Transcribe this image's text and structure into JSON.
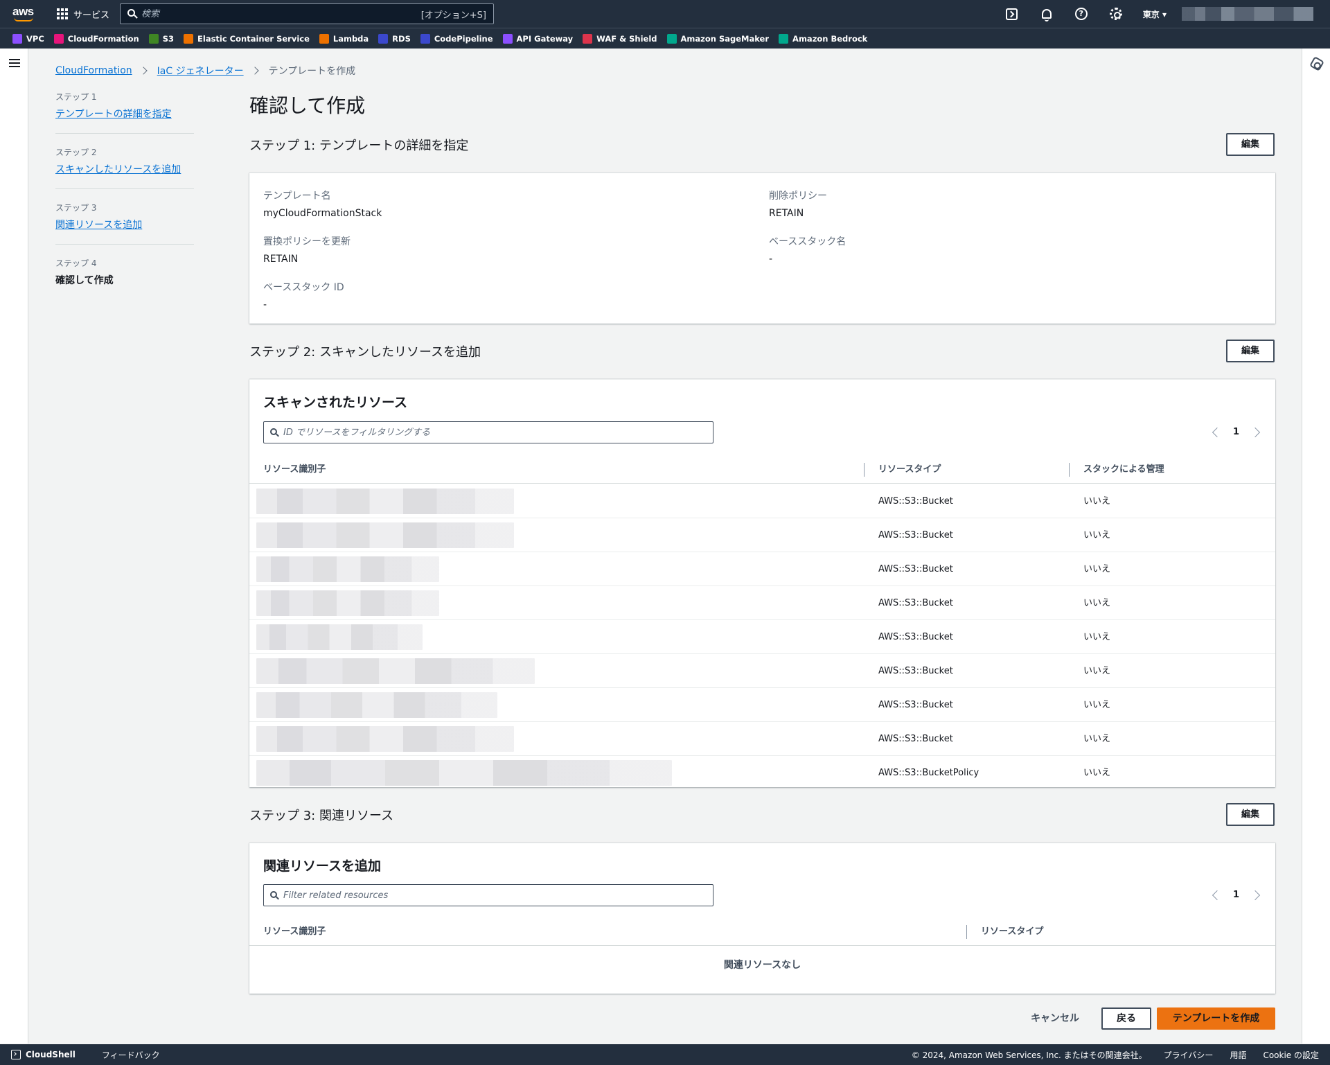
{
  "nav": {
    "logo": "aws",
    "services_label": "サービス",
    "search_placeholder": "検索",
    "search_shortcut": "[オプション+S]",
    "region": "東京 ▾",
    "icons": [
      "cloudshell-icon",
      "bell-icon",
      "help-icon",
      "gear-icon"
    ]
  },
  "favorites": [
    {
      "label": "VPC",
      "color": "#8c4fff"
    },
    {
      "label": "CloudFormation",
      "color": "#e7157b"
    },
    {
      "label": "S3",
      "color": "#3f8624"
    },
    {
      "label": "Elastic Container Service",
      "color": "#ed7100"
    },
    {
      "label": "Lambda",
      "color": "#ed7100"
    },
    {
      "label": "RDS",
      "color": "#3b48cc"
    },
    {
      "label": "CodePipeline",
      "color": "#3b48cc"
    },
    {
      "label": "API Gateway",
      "color": "#8c4fff"
    },
    {
      "label": "WAF & Shield",
      "color": "#dd344c"
    },
    {
      "label": "Amazon SageMaker",
      "color": "#01a88d"
    },
    {
      "label": "Amazon Bedrock",
      "color": "#01a88d"
    }
  ],
  "breadcrumb": {
    "items": [
      "CloudFormation",
      "IaC ジェネレーター"
    ],
    "current": "テンプレートを作成"
  },
  "steps": [
    {
      "num": "ステップ 1",
      "label": "テンプレートの詳細を指定"
    },
    {
      "num": "ステップ 2",
      "label": "スキャンしたリソースを追加"
    },
    {
      "num": "ステップ 3",
      "label": "関連リソースを追加"
    },
    {
      "num": "ステップ 4",
      "label": "確認して作成"
    }
  ],
  "page_title": "確認して作成",
  "edit_label": "編集",
  "section1": {
    "title": "ステップ 1: テンプレートの詳細を指定",
    "fields": [
      {
        "label": "テンプレート名",
        "value": "myCloudFormationStack"
      },
      {
        "label": "削除ポリシー",
        "value": "RETAIN"
      },
      {
        "label": "置換ポリシーを更新",
        "value": "RETAIN"
      },
      {
        "label": "ベーススタック名",
        "value": "-"
      },
      {
        "label": "ベーススタック ID",
        "value": "-"
      }
    ]
  },
  "section2": {
    "title": "ステップ 2: スキャンしたリソースを追加",
    "table_title": "スキャンされたリソース",
    "filter_placeholder": "ID でリソースをフィルタリングする",
    "page": "1",
    "columns": [
      "リソース識別子",
      "リソースタイプ",
      "スタックによる管理"
    ],
    "rows": [
      {
        "type": "AWS::S3::Bucket",
        "managed": "いいえ",
        "redact": 0.62
      },
      {
        "type": "AWS::S3::Bucket",
        "managed": "いいえ",
        "redact": 0.62
      },
      {
        "type": "AWS::S3::Bucket",
        "managed": "いいえ",
        "redact": 0.44
      },
      {
        "type": "AWS::S3::Bucket",
        "managed": "いいえ",
        "redact": 0.44
      },
      {
        "type": "AWS::S3::Bucket",
        "managed": "いいえ",
        "redact": 0.4
      },
      {
        "type": "AWS::S3::Bucket",
        "managed": "いいえ",
        "redact": 0.67
      },
      {
        "type": "AWS::S3::Bucket",
        "managed": "いいえ",
        "redact": 0.58
      },
      {
        "type": "AWS::S3::Bucket",
        "managed": "いいえ",
        "redact": 0.62
      },
      {
        "type": "AWS::S3::BucketPolicy",
        "managed": "いいえ",
        "redact": 1.0
      }
    ]
  },
  "section3": {
    "title": "ステップ 3: 関連リソース",
    "table_title": "関連リソースを追加",
    "filter_placeholder": "Filter related resources",
    "page": "1",
    "columns": [
      "リソース識別子",
      "リソースタイプ"
    ],
    "empty": "関連リソースなし"
  },
  "actions": {
    "cancel": "キャンセル",
    "back": "戻る",
    "create": "テンプレートを作成"
  },
  "footer": {
    "cloudshell": "CloudShell",
    "feedback": "フィードバック",
    "copyright": "© 2024, Amazon Web Services, Inc. またはその関連会社。",
    "privacy": "プライバシー",
    "terms": "用語",
    "cookie": "Cookie の設定"
  }
}
